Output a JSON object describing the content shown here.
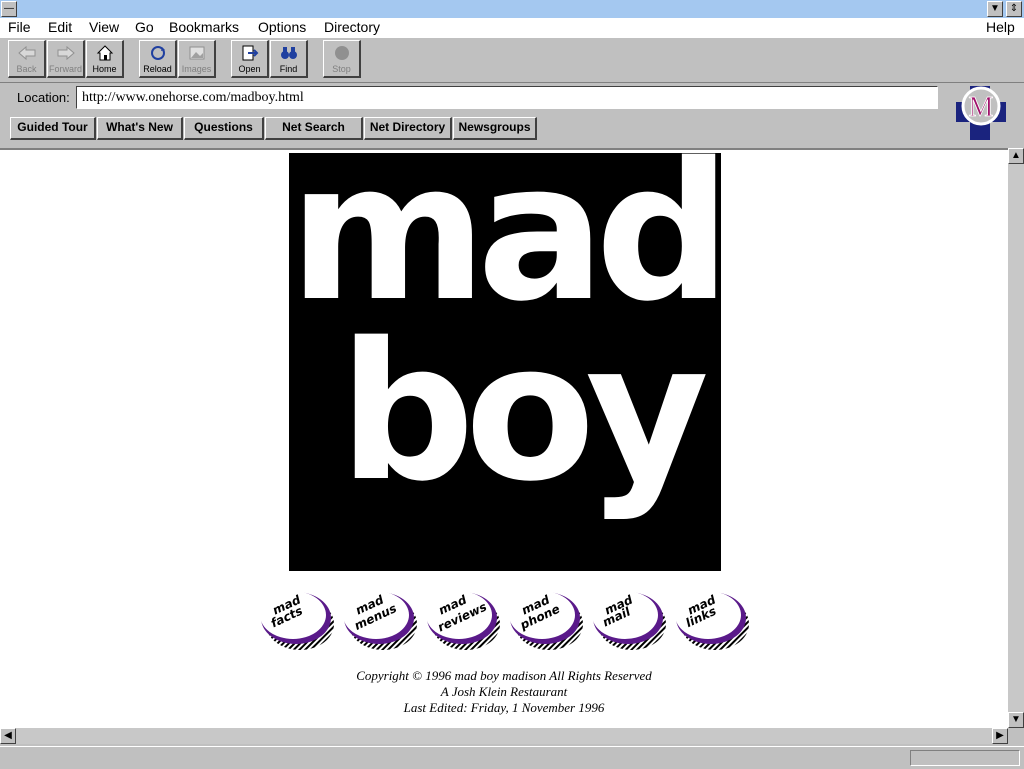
{
  "menubar": {
    "file": "File",
    "edit": "Edit",
    "view": "View",
    "go": "Go",
    "bookmarks": "Bookmarks",
    "options": "Options",
    "directory": "Directory",
    "help": "Help"
  },
  "toolbar": {
    "back": "Back",
    "forward": "Forward",
    "home": "Home",
    "reload": "Reload",
    "images": "Images",
    "open": "Open",
    "find": "Find",
    "stop": "Stop"
  },
  "location": {
    "label": "Location:",
    "url": "http://www.onehorse.com/madboy.html"
  },
  "directory_buttons": [
    "Guided Tour",
    "What's New",
    "Questions",
    "Net Search",
    "Net Directory",
    "Newsgroups"
  ],
  "page": {
    "logo_line1": "mad",
    "logo_line2": "boy",
    "nav_buttons": [
      {
        "top": "mad",
        "bottom": "facts"
      },
      {
        "top": "mad",
        "bottom": "menus"
      },
      {
        "top": "mad",
        "bottom": "reviews"
      },
      {
        "top": "mad",
        "bottom": "phone"
      },
      {
        "top": "mad",
        "bottom": "mail"
      },
      {
        "top": "mad",
        "bottom": "links"
      }
    ],
    "copyright": "Copyright © 1996 mad boy madison All Rights Reserved",
    "tagline": "A Josh Klein Restaurant",
    "last_edited": "Last Edited: Friday, 1 November 1996"
  },
  "colors": {
    "title_bar": "#a4c8f0",
    "button_purple": "#5a1a8a",
    "logo_bg": "#000000"
  }
}
